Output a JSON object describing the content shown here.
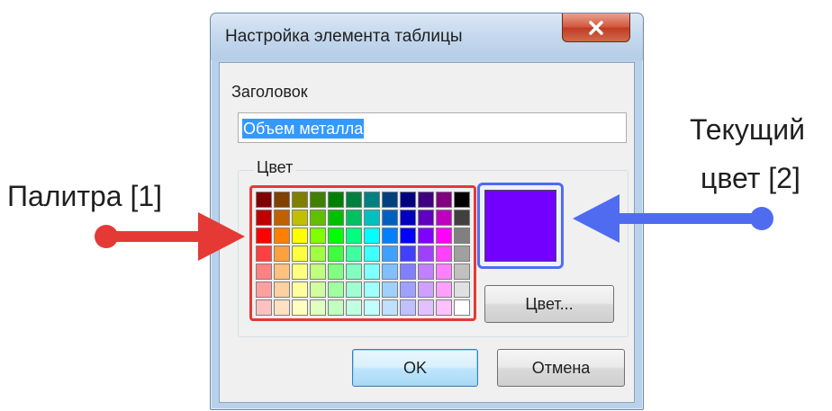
{
  "dialog": {
    "title": "Настройка элемента таблицы",
    "close_icon": "close-icon",
    "header_label": "Заголовок",
    "title_value": "Объем металла",
    "group_label": "Цвет",
    "current_color": "#7300ff",
    "color_button_label": "Цвет...",
    "ok_label": "OK",
    "cancel_label": "Отмена"
  },
  "palette": {
    "columns": 12,
    "rows": [
      [
        "#800000",
        "#804000",
        "#808000",
        "#408000",
        "#008000",
        "#008040",
        "#008080",
        "#004080",
        "#000080",
        "#400080",
        "#800080",
        "#000000"
      ],
      [
        "#c00000",
        "#c06000",
        "#c0c000",
        "#60c000",
        "#00c000",
        "#00c060",
        "#00c0c0",
        "#0060c0",
        "#0000c0",
        "#6000c0",
        "#c000c0",
        "#404040"
      ],
      [
        "#ff0000",
        "#ff8000",
        "#ffff00",
        "#80ff00",
        "#00ff00",
        "#00ff80",
        "#00ffff",
        "#0080ff",
        "#0000ff",
        "#8000ff",
        "#ff00ff",
        "#808080"
      ],
      [
        "#ff4040",
        "#ffa040",
        "#ffff40",
        "#a0ff40",
        "#40ff40",
        "#40ffa0",
        "#40ffff",
        "#40a0ff",
        "#4040ff",
        "#a040ff",
        "#ff40ff",
        "#a0a0a0"
      ],
      [
        "#ff8080",
        "#ffc080",
        "#ffff80",
        "#c0ff80",
        "#80ff80",
        "#80ffc0",
        "#80ffff",
        "#80c0ff",
        "#8080ff",
        "#c080ff",
        "#ff80ff",
        "#c0c0c0"
      ],
      [
        "#ffa0a0",
        "#ffd0a0",
        "#ffffa0",
        "#d0ffa0",
        "#a0ffa0",
        "#a0ffd0",
        "#a0ffff",
        "#a0d0ff",
        "#a0a0ff",
        "#d0a0ff",
        "#ffa0ff",
        "#e0e0e0"
      ],
      [
        "#ffc0c0",
        "#ffe0c0",
        "#ffffc0",
        "#e0ffc0",
        "#c0ffc0",
        "#c0ffe0",
        "#c0ffff",
        "#c0e0ff",
        "#c0c0ff",
        "#e0c0ff",
        "#ffc0ff",
        "#ffffff"
      ]
    ]
  },
  "annotations": {
    "palette_label": "Палитра [1]",
    "current_line1": "Текущий",
    "current_line2": "цвет [2]",
    "palette_arrow_color": "#e53935",
    "current_arrow_color": "#4f6cf0"
  }
}
